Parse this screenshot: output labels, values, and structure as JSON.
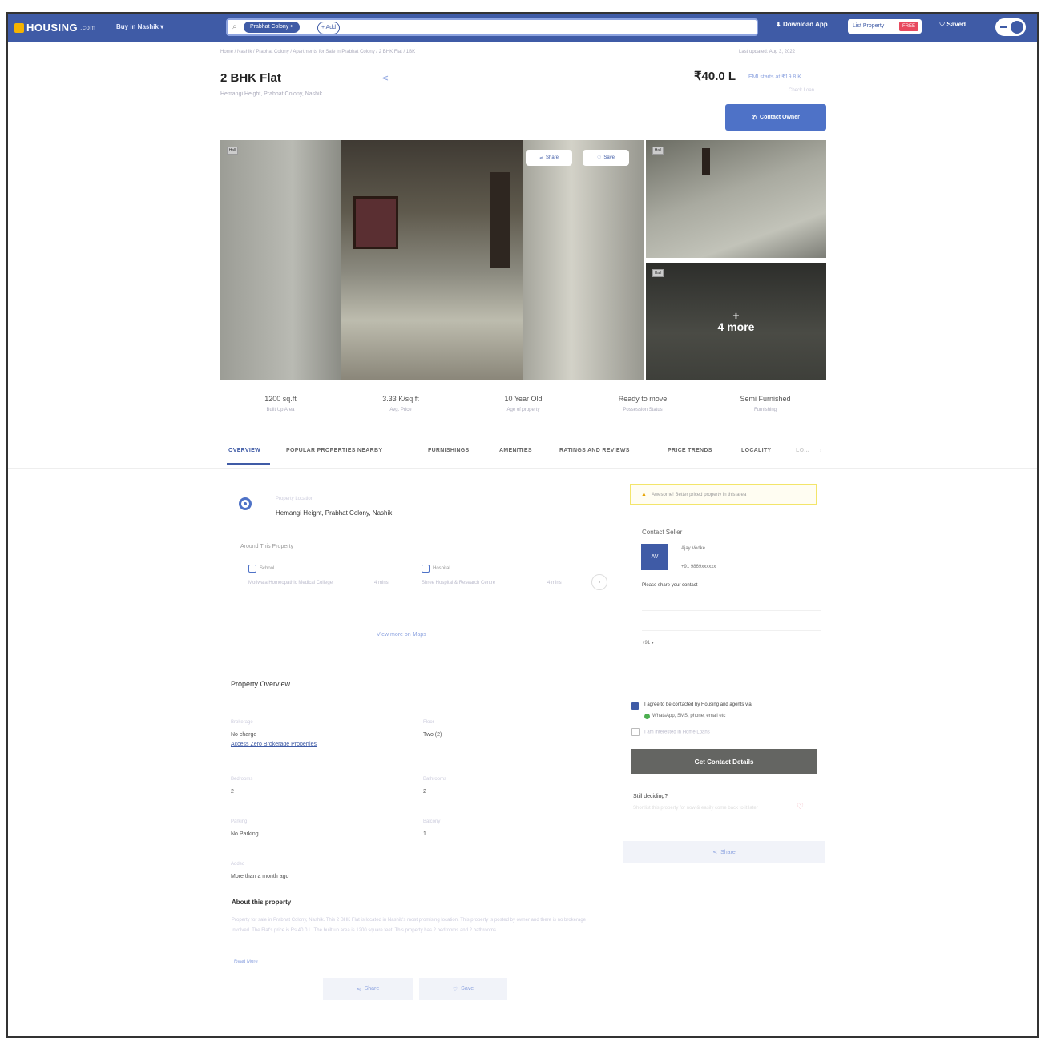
{
  "header": {
    "logo": "HOUSING",
    "logo_suffix": ".com",
    "city_selector": "Buy in Nashik",
    "search_chip": "Prabhat Colony",
    "search_add": "+ Add",
    "download_app": "Download App",
    "list_property": "List Property",
    "free_badge": "FREE",
    "saved": "Saved"
  },
  "listing": {
    "breadcrumb": "Home / Nashik / Prabhat Colony / Apartments for Sale in Prabhat Colony / 2 BHK Flat / 1BK",
    "posted": "Last updated: Aug 3, 2022",
    "title": "2 BHK Flat",
    "address_sub": "Hemangi Height, Prabhat Colony, Nashik",
    "price": "₹40.0 L",
    "emi": "EMI starts at ₹19.8 K",
    "emi_sub": "Check Loan",
    "contact_owner": "Contact Owner"
  },
  "gallery": {
    "share": "Share",
    "save": "Save",
    "more": "4 more",
    "plus": "+",
    "badge": "Hall"
  },
  "stats": [
    {
      "value": "1200 sq.ft",
      "label": "Built Up Area"
    },
    {
      "value": "3.33 K/sq.ft",
      "label": "Avg. Price"
    },
    {
      "value": "10 Year Old",
      "label": "Age of property"
    },
    {
      "value": "Ready to move",
      "label": "Possession Status"
    },
    {
      "value": "Semi Furnished",
      "label": "Furnishing"
    }
  ],
  "tabs": [
    "OVERVIEW",
    "POPULAR PROPERTIES NEARBY",
    "FURNISHINGS",
    "AMENITIES",
    "RATINGS AND REVIEWS",
    "PRICE TRENDS",
    "LOCALITY",
    "LO..."
  ],
  "location": {
    "label": "Property Location",
    "value": "Hemangi Height, Prabhat Colony, Nashik",
    "around": "Around This Property",
    "poi": [
      {
        "type": "School",
        "name": "Motiwala Homeopathic Medical College",
        "distance": "4 mins"
      },
      {
        "type": "Hospital",
        "name": "Shree Hospital & Research Centre",
        "distance": "4 mins"
      }
    ],
    "view_maps": "View more on Maps"
  },
  "seller": {
    "alert": "Awesome! Better priced property in this area",
    "contact_title": "Contact Seller",
    "initials": "AV",
    "name": "Ajay Vedke",
    "phone": "+91 9869xxxxxx",
    "please_share": "Please share your contact",
    "country_code": "+91 ▾",
    "agree": "I agree to be contacted by Housing and agents via",
    "agree_channels": "WhatsApp, SMS, phone, email etc",
    "home_loan": "I am interested in Home Loans",
    "get_details": "Get Contact Details",
    "still_deciding": "Still deciding?",
    "still_deciding_sub": "Shortlist this property for now & easily come back to it later",
    "share": "Share"
  },
  "overview": {
    "title": "Property Overview",
    "items": [
      {
        "key": "Brokerage",
        "value": "No charge",
        "link": "Access Zero Brokerage Properties"
      },
      {
        "key": "Floor",
        "value": "Two (2)"
      },
      {
        "key": "Bedrooms",
        "value": "2"
      },
      {
        "key": "Bathrooms",
        "value": "2"
      },
      {
        "key": "Parking",
        "value": "No Parking"
      },
      {
        "key": "Balcony",
        "value": "1"
      },
      {
        "key": "Added",
        "value": "More than a month ago"
      }
    ]
  },
  "about": {
    "title": "About this property",
    "text": "Property for sale in Prabhat Colony, Nashik. This 2 BHK Flat is located in Nashik's most promising location. This property is posted by owner and there is no brokerage involved. The Flat's price is Rs 40.0 L. The built up area is 1200 square feet. This property has 2 bedrooms and 2 bathrooms...",
    "read_more": "Read More",
    "share": "Share",
    "save": "Save"
  },
  "colors": {
    "brand": "#3f5ba6",
    "accent": "#4e72c7",
    "alert_border": "#f3e56a",
    "cta_grey": "#646562"
  }
}
